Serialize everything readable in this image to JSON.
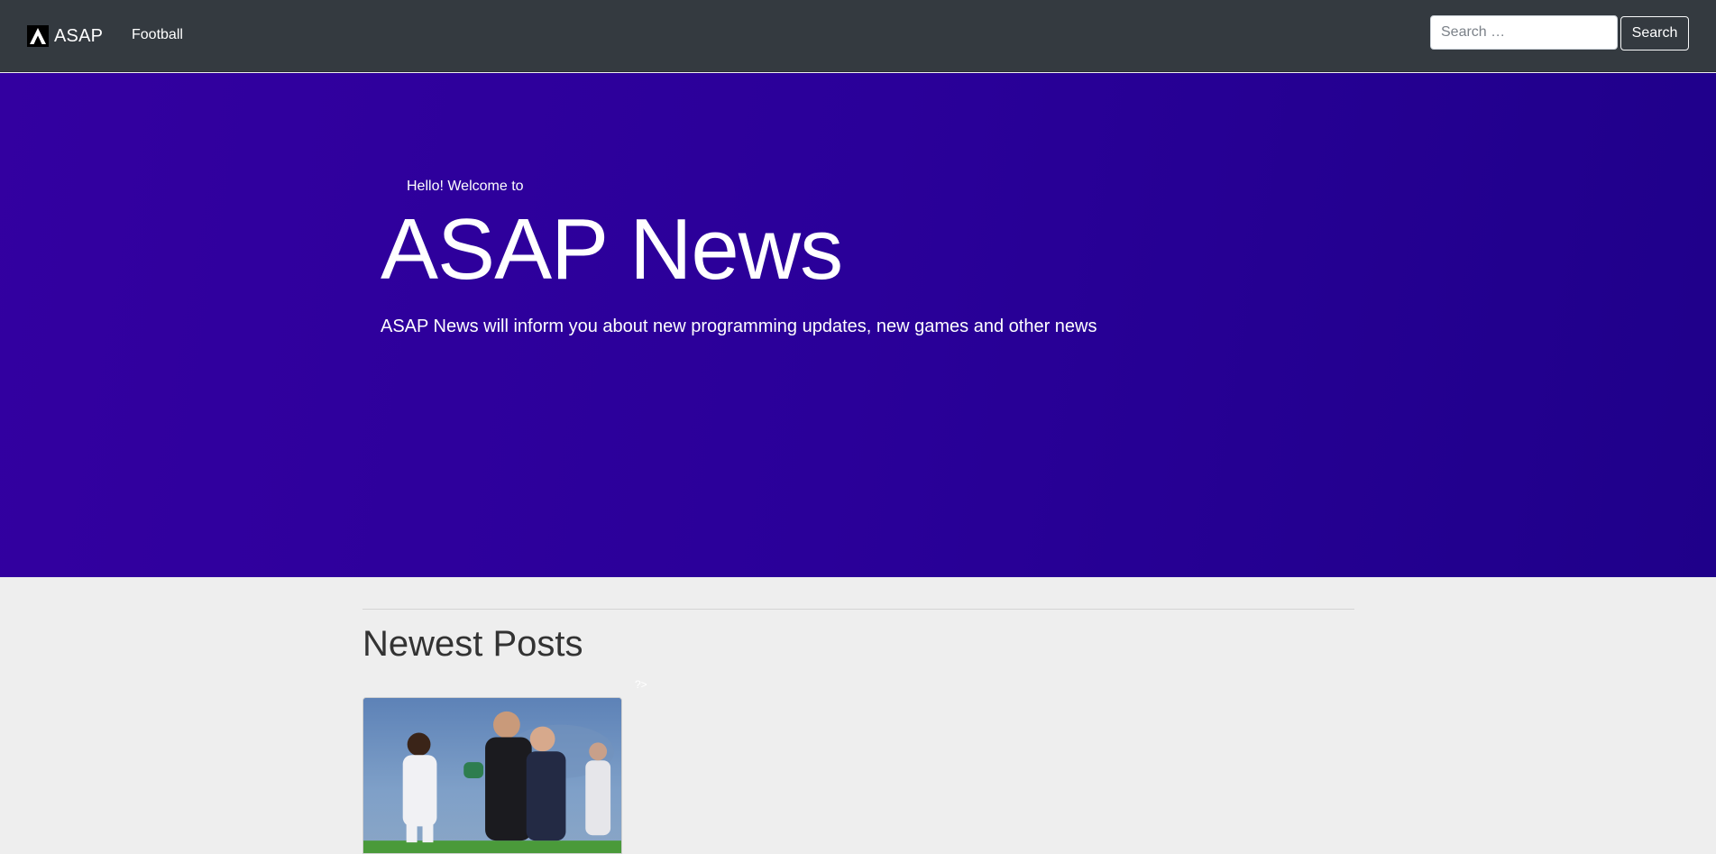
{
  "navbar": {
    "brand_text": "ASAP",
    "links": [
      {
        "label": "Football"
      }
    ],
    "search": {
      "placeholder": "Search …",
      "value": "",
      "button_label": "Search"
    }
  },
  "hero": {
    "greeting": "Hello! Welcome to",
    "title": "ASAP News",
    "tagline": "ASAP News will inform you about new programming updates, new games and other news"
  },
  "main": {
    "section_heading": "Newest Posts",
    "stray_text": "?>",
    "posts": [
      {
        "image_alt": ""
      }
    ]
  },
  "colors": {
    "navbar_bg": "#343a40",
    "hero_bg": "#2a0099",
    "page_bg": "#eeeeee",
    "text_light": "#ffffff"
  },
  "icons": {
    "brand_logo": "letter-a-logo-icon"
  }
}
